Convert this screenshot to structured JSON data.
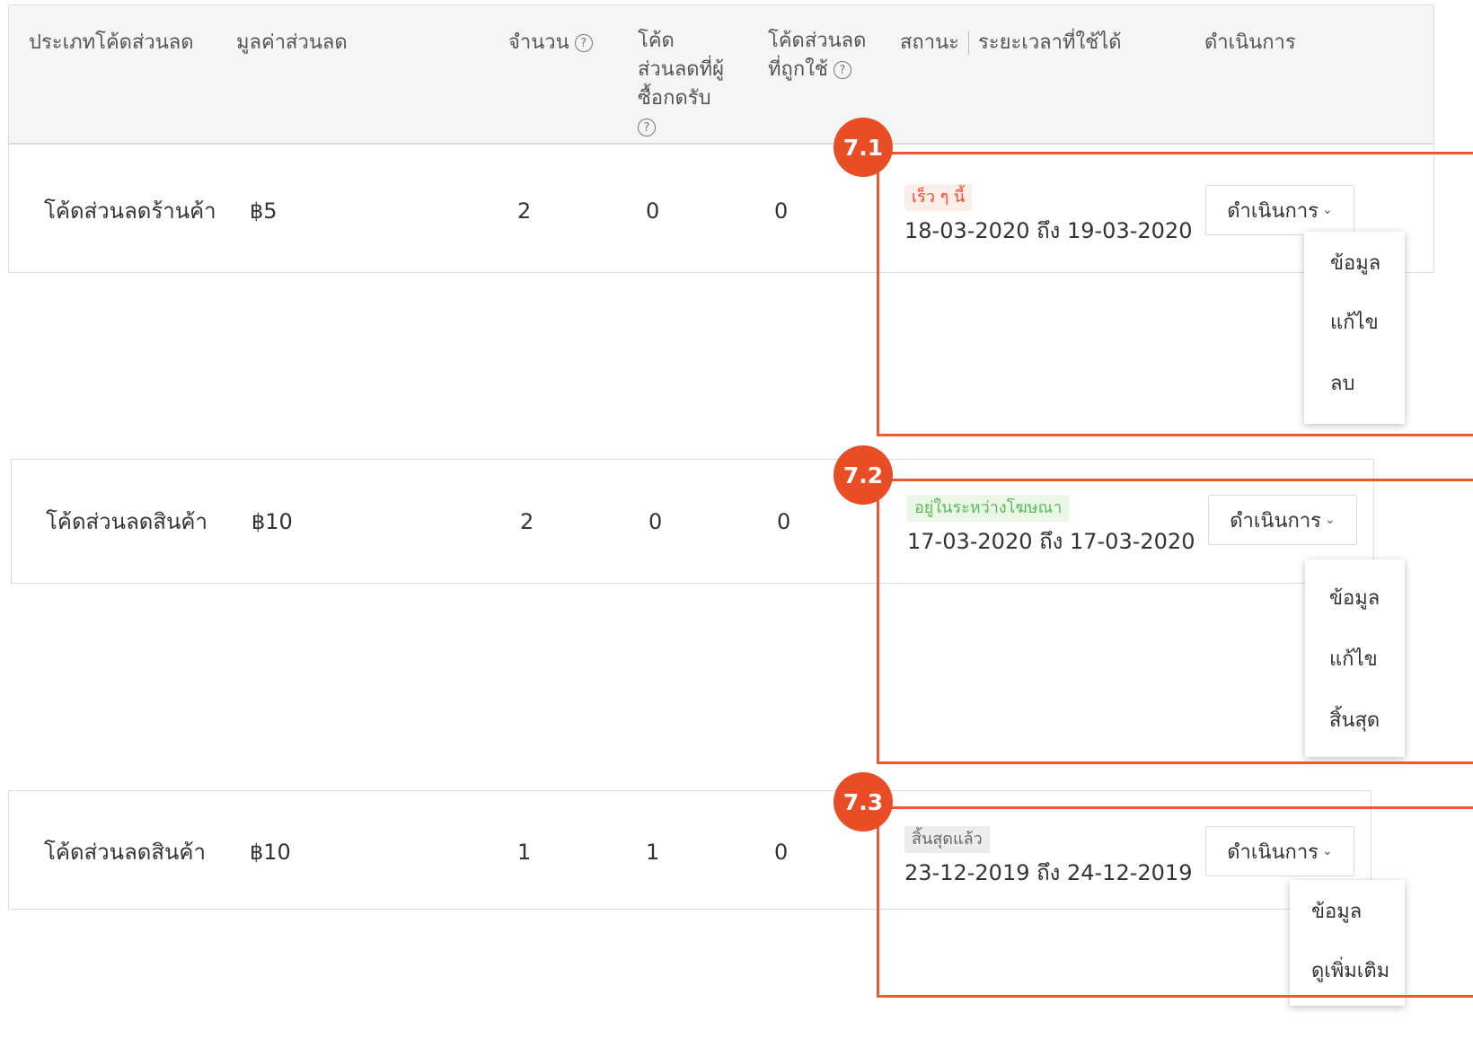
{
  "header": {
    "col_type": "ประเภทโค้ดส่วนลด",
    "col_value": "มูลค่าส่วนลด",
    "col_quantity": "จำนวน",
    "col_claimed_line1": "โค้ด",
    "col_claimed_line2": "ส่วนลดที่ผู้",
    "col_claimed_line3": "ซื้อกดรับ",
    "col_used_line1": "โค้ดส่วนลด",
    "col_used_line2": "ที่ถูกใช้",
    "col_status": "สถานะ",
    "col_period": "ระยะเวลาที่ใช้ได้",
    "col_action": "ดำเนินการ",
    "help_glyph": "?"
  },
  "rows": [
    {
      "callout": "7.1",
      "type": "โค้ดส่วนลดร้านค้า",
      "value": "฿5",
      "quantity": "2",
      "claimed": "0",
      "used": "0",
      "status": "เร็ว ๆ นี้",
      "status_color": "#ee4d2d",
      "status_bg": "#fdeee9",
      "period": "18-03-2020 ถึง 19-03-2020",
      "action_label": "ดำเนินการ",
      "menu": [
        "ข้อมูล",
        "แก้ไข",
        "ลบ"
      ]
    },
    {
      "callout": "7.2",
      "type": "โค้ดส่วนลดสินค้า",
      "value": "฿10",
      "quantity": "2",
      "claimed": "0",
      "used": "0",
      "status": "อยู่ในระหว่างโฆษณา",
      "status_color": "#5cb85c",
      "status_bg": "#eaf6e6",
      "period": "17-03-2020 ถึง 17-03-2020",
      "action_label": "ดำเนินการ",
      "menu": [
        "ข้อมูล",
        "แก้ไข",
        "สิ้นสุด"
      ]
    },
    {
      "callout": "7.3",
      "type": "โค้ดส่วนลดสินค้า",
      "value": "฿10",
      "quantity": "1",
      "claimed": "1",
      "used": "0",
      "status": "สิ้นสุดแล้ว",
      "status_color": "#666666",
      "status_bg": "#ececec",
      "period": "23-12-2019 ถึง 24-12-2019",
      "action_label": "ดำเนินการ",
      "menu": [
        "ข้อมูล",
        "ดูเพิ่มเติม"
      ]
    }
  ],
  "colors": {
    "callout": "#e84d26",
    "frame": "#ec5830"
  },
  "icons": {
    "help": "question-circle-icon",
    "dropdown": "chevron-down-icon"
  }
}
